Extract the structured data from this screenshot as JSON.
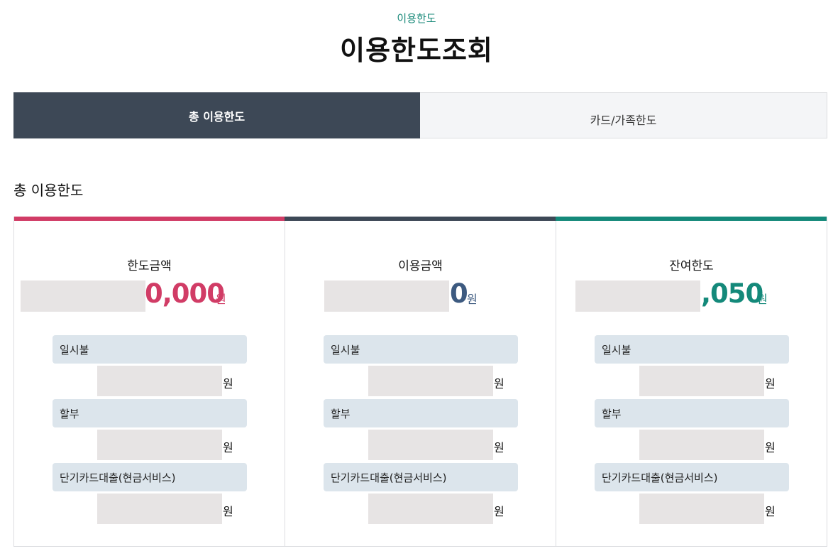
{
  "header": {
    "eyebrow": "이용한도",
    "title": "이용한도조회"
  },
  "tabs": [
    {
      "label": "총 이용한도",
      "active": true
    },
    {
      "label": "카드/가족한도",
      "active": false
    }
  ],
  "section": {
    "title": "총 이용한도"
  },
  "colors": {
    "limit_accent": "#d13c66",
    "usage_accent": "#3d4856",
    "remaining_accent": "#14897a",
    "tab_active_bg": "#3d4856",
    "subheader_bg": "#dce5ec",
    "mask_bg": "#e7e4e4"
  },
  "unit": "원",
  "cards": [
    {
      "label": "한도금액",
      "amount_visible": "0,000",
      "unit": "원",
      "accent": "#d13c66",
      "items": [
        {
          "label": "일시불",
          "unit": "원"
        },
        {
          "label": "할부",
          "unit": "원"
        },
        {
          "label": "단기카드대출(현금서비스)",
          "unit": "원"
        }
      ]
    },
    {
      "label": "이용금액",
      "amount_visible": "0",
      "unit": "원",
      "accent": "#3d4856",
      "items": [
        {
          "label": "일시불",
          "unit": "원"
        },
        {
          "label": "할부",
          "unit": "원"
        },
        {
          "label": "단기카드대출(현금서비스)",
          "unit": "원"
        }
      ]
    },
    {
      "label": "잔여한도",
      "amount_visible": ",050",
      "unit": "원",
      "accent": "#14897a",
      "items": [
        {
          "label": "일시불",
          "unit": "원"
        },
        {
          "label": "할부",
          "unit": "원"
        },
        {
          "label": "단기카드대출(현금서비스)",
          "unit": "원"
        }
      ]
    }
  ]
}
